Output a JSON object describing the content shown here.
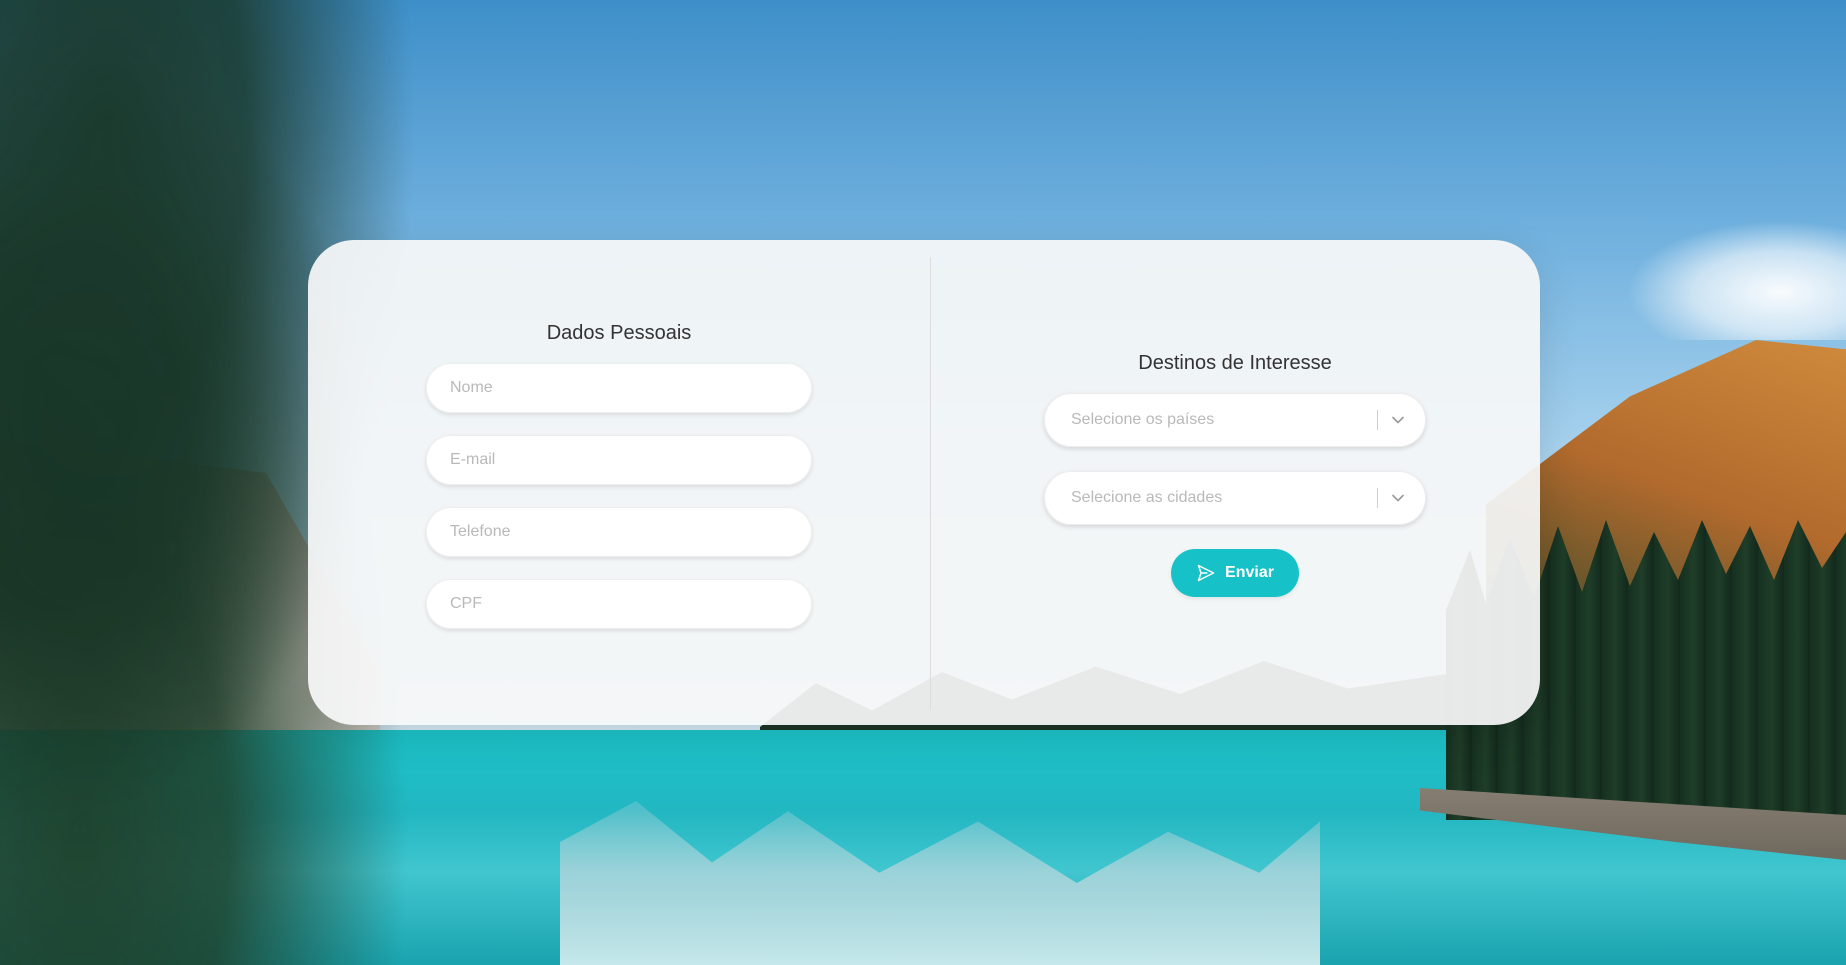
{
  "personal": {
    "title": "Dados Pessoais",
    "name_placeholder": "Nome",
    "email_placeholder": "E-mail",
    "phone_placeholder": "Telefone",
    "cpf_placeholder": "CPF"
  },
  "destinations": {
    "title": "Destinos de Interesse",
    "countries_placeholder": "Selecione os países",
    "cities_placeholder": "Selecione as cidades",
    "submit_label": "Enviar"
  },
  "icons": {
    "select_chevron": "chevron-down-icon",
    "submit": "send-icon"
  },
  "colors": {
    "accent": "#16c2c8",
    "card": "#f6f7f8"
  }
}
